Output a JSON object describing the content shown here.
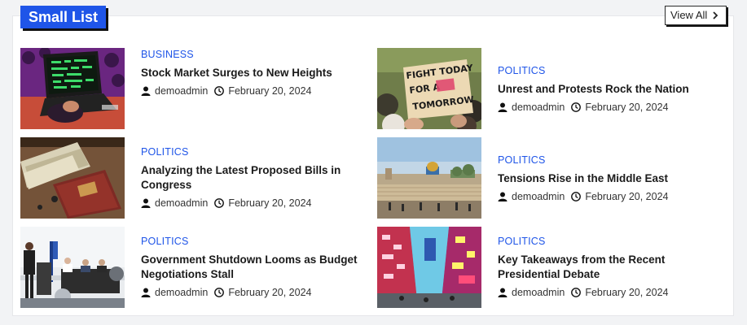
{
  "widget": {
    "title": "Small List",
    "view_all_label": "View All",
    "accent_color": "#1f55e8"
  },
  "posts": [
    {
      "category": "BUSINESS",
      "title": "Stock Market Surges to New Heights",
      "author": "demoadmin",
      "date": "February 20, 2024",
      "image": "trader-laptop-charts"
    },
    {
      "category": "POLITICS",
      "title": "Unrest and Protests Rock the Nation",
      "author": "demoadmin",
      "date": "February 20, 2024",
      "image": "protest-sign",
      "image_sign_text": [
        "FIGHT TODAY",
        "FOR A",
        "TOMORROW"
      ]
    },
    {
      "category": "POLITICS",
      "title": "Analyzing the Latest Proposed Bills in Congress",
      "author": "demoadmin",
      "date": "February 20, 2024",
      "image": "passport-and-banknotes"
    },
    {
      "category": "POLITICS",
      "title": "Tensions Rise in the Middle East",
      "author": "demoadmin",
      "date": "February 20, 2024",
      "image": "jerusalem-old-city"
    },
    {
      "category": "POLITICS",
      "title": "Government Shutdown Looms as Budget Negotiations Stall",
      "author": "demoadmin",
      "date": "February 20, 2024",
      "image": "press-conference-podium"
    },
    {
      "category": "POLITICS",
      "title": "Key Takeaways from the Recent Presidential Debate",
      "author": "demoadmin",
      "date": "February 20, 2024",
      "image": "neon-city-street"
    }
  ]
}
